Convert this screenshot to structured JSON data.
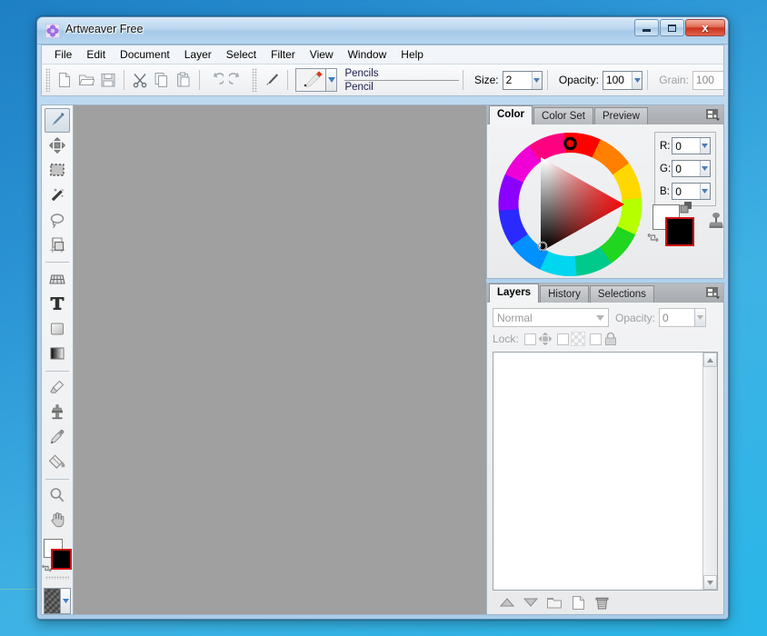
{
  "window": {
    "title": "Artweaver Free",
    "icon": "artweaver-flower-icon",
    "buttons": {
      "minimize": "minimize-button",
      "maximize": "maximize-button",
      "close_label": "x"
    }
  },
  "menubar": {
    "items": [
      {
        "label": "File",
        "name": "menu-file"
      },
      {
        "label": "Edit",
        "name": "menu-edit"
      },
      {
        "label": "Document",
        "name": "menu-document"
      },
      {
        "label": "Layer",
        "name": "menu-layer"
      },
      {
        "label": "Select",
        "name": "menu-select"
      },
      {
        "label": "Filter",
        "name": "menu-filter"
      },
      {
        "label": "View",
        "name": "menu-view"
      },
      {
        "label": "Window",
        "name": "menu-window"
      },
      {
        "label": "Help",
        "name": "menu-help"
      }
    ]
  },
  "toolbar": {
    "icons": [
      "new-document-icon",
      "open-folder-icon",
      "save-disk-icon",
      "cut-scissors-icon",
      "copy-icon",
      "paste-icon",
      "undo-icon",
      "redo-icon",
      "brush-icon"
    ],
    "brush_category": "Pencils",
    "brush_name": "Pencil",
    "size_label": "Size:",
    "size_value": "2",
    "opacity_label": "Opacity:",
    "opacity_value": "100",
    "grain_label": "Grain:",
    "grain_value": "100"
  },
  "tools": {
    "items": [
      {
        "name": "tool-brush",
        "icon": "paintbrush-icon",
        "selected": true
      },
      {
        "name": "tool-move",
        "icon": "move-arrows-icon",
        "selected": false
      },
      {
        "name": "tool-rect-select",
        "icon": "rectangular-marquee-icon",
        "selected": false
      },
      {
        "name": "tool-magic-wand",
        "icon": "magic-wand-icon",
        "selected": false
      },
      {
        "name": "tool-lasso",
        "icon": "lasso-icon",
        "selected": false
      },
      {
        "name": "tool-crop",
        "icon": "crop-icon",
        "selected": false
      },
      {
        "name": "tool-perspective",
        "icon": "perspective-grid-icon",
        "selected": false
      },
      {
        "name": "tool-text",
        "icon": "text-T-icon",
        "selected": false
      },
      {
        "name": "tool-shape",
        "icon": "rounded-rect-shape-icon",
        "selected": false
      },
      {
        "name": "tool-gradient",
        "icon": "gradient-icon",
        "selected": false
      },
      {
        "name": "tool-eraser",
        "icon": "eraser-icon",
        "selected": false
      },
      {
        "name": "tool-clone-stamp",
        "icon": "clone-stamp-icon",
        "selected": false
      },
      {
        "name": "tool-eyedropper",
        "icon": "eyedropper-icon",
        "selected": false
      },
      {
        "name": "tool-paint-bucket",
        "icon": "paint-bucket-icon",
        "selected": false
      },
      {
        "name": "tool-zoom",
        "icon": "magnifier-icon",
        "selected": false
      },
      {
        "name": "tool-hand",
        "icon": "hand-icon",
        "selected": false
      }
    ],
    "foreground_color": "#000000",
    "background_color": "#ffffff",
    "swap_icon": "swap-colors-icon",
    "texture_icon": "texture-swatch-icon"
  },
  "canvas": {
    "background_color": "#a0a0a0"
  },
  "color_panel": {
    "tabs": [
      {
        "label": "Color",
        "active": true
      },
      {
        "label": "Color Set",
        "active": false
      },
      {
        "label": "Preview",
        "active": false
      }
    ],
    "menu_icon": "panel-menu-icon",
    "wheel_icon": "hsv-color-wheel",
    "channels": [
      {
        "label": "R:",
        "value": "0"
      },
      {
        "label": "G:",
        "value": "0"
      },
      {
        "label": "B:",
        "value": "0"
      }
    ],
    "foreground_color": "#000000",
    "background_color": "#ffffff",
    "selected_hue_deg": 0,
    "clone_icon": "color-clone-icon",
    "swap_icon": "swap-colors-icon"
  },
  "layers_panel": {
    "tabs": [
      {
        "label": "Layers",
        "active": true
      },
      {
        "label": "History",
        "active": false
      },
      {
        "label": "Selections",
        "active": false
      }
    ],
    "menu_icon": "panel-menu-icon",
    "blend_mode": "Normal",
    "opacity_label": "Opacity:",
    "opacity_value": "0",
    "lock_label": "Lock:",
    "lock_items": [
      {
        "name": "lock-position",
        "icon": "move-arrows-icon",
        "checked": false
      },
      {
        "name": "lock-transparency",
        "icon": "transparency-checker-icon",
        "checked": false
      },
      {
        "name": "lock-all",
        "icon": "padlock-icon",
        "checked": false
      }
    ],
    "layers": [],
    "bottom_buttons": [
      {
        "name": "move-layer-up-button",
        "icon": "triangle-up-icon"
      },
      {
        "name": "move-layer-down-button",
        "icon": "triangle-down-icon"
      },
      {
        "name": "new-group-button",
        "icon": "folder-icon"
      },
      {
        "name": "new-layer-button",
        "icon": "page-icon"
      },
      {
        "name": "delete-layer-button",
        "icon": "trash-icon"
      }
    ]
  }
}
